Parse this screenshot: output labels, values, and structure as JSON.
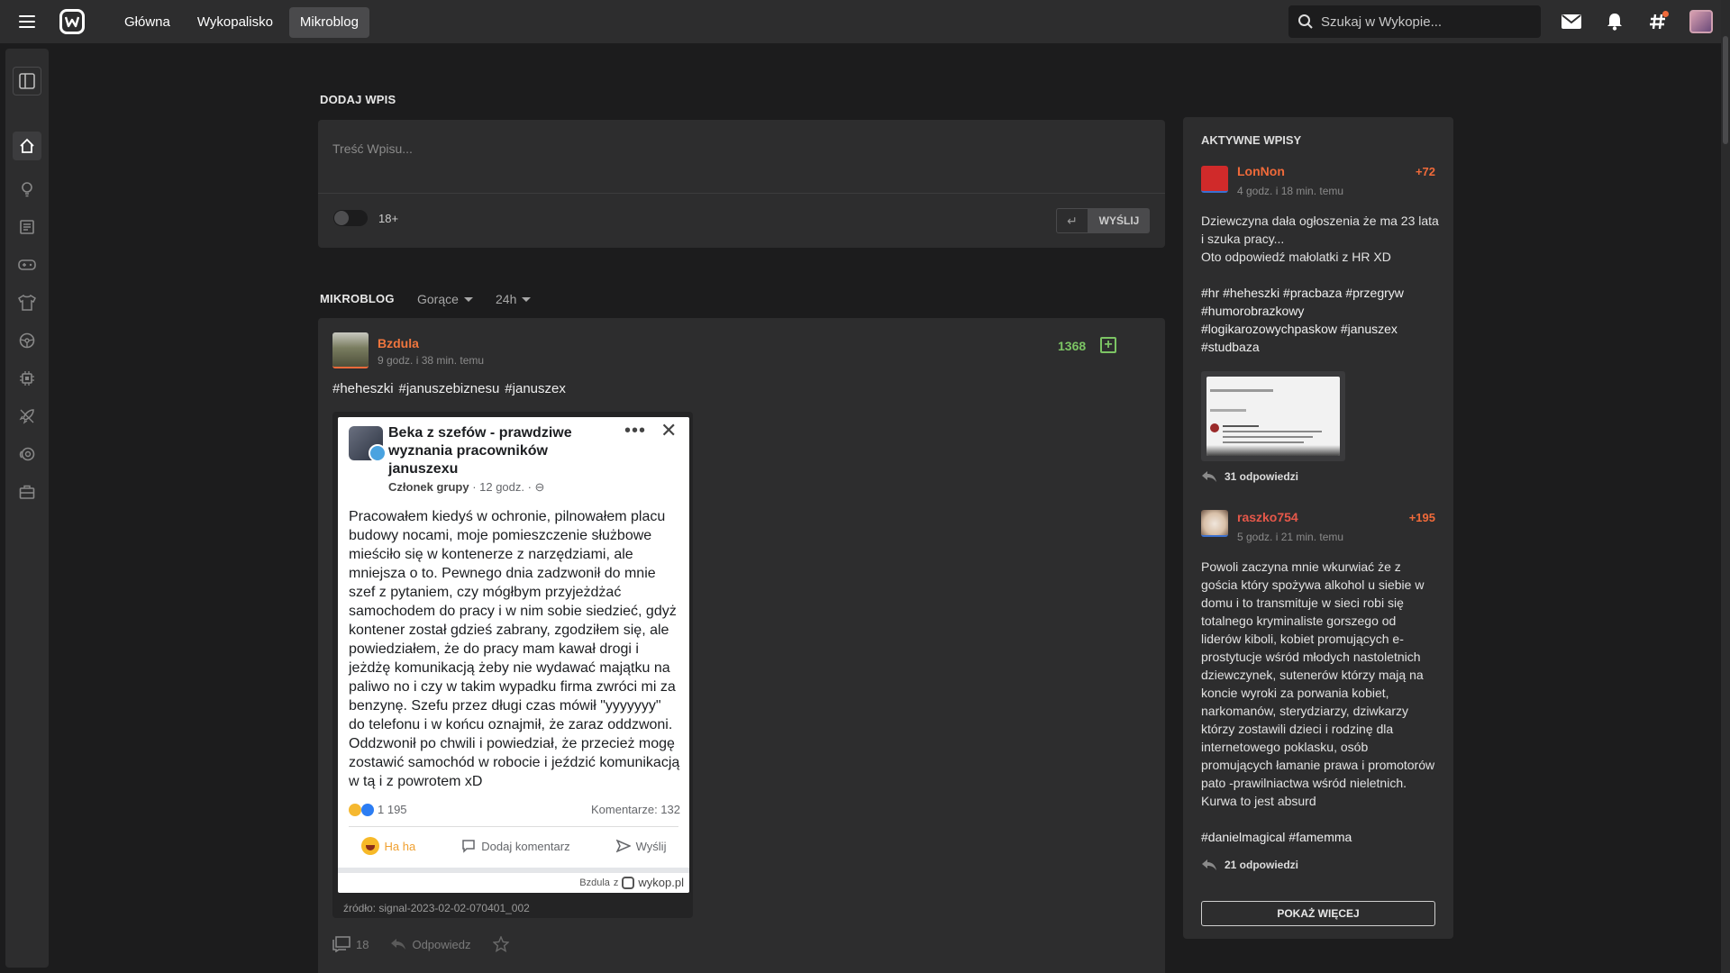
{
  "topbar": {
    "nav": [
      "Główna",
      "Wykopalisko",
      "Mikroblog"
    ],
    "active_nav": "Mikroblog",
    "search_placeholder": "Szukaj w Wykopie..."
  },
  "sidebar": {
    "icons": [
      "panel-toggle-icon",
      "home-icon",
      "lightbulb-icon",
      "news-icon",
      "gamepad-icon",
      "tshirt-icon",
      "steering-wheel-icon",
      "chip-icon",
      "rocket-icon",
      "coin-icon",
      "briefcase-icon"
    ]
  },
  "composer": {
    "section_title": "DODAJ WPIS",
    "placeholder": "Treść Wpisu...",
    "age_label": "18+",
    "send_label": "WYŚLIJ"
  },
  "feed": {
    "section_title": "MIKROBLOG",
    "sort_label": "Gorące",
    "period_label": "24h"
  },
  "post": {
    "author": "Bzdula",
    "time": "9 godz. i 38 min. temu",
    "votes": "1368",
    "tags": [
      "#heheszki",
      "#januszebiznesu",
      "#januszex"
    ],
    "embed": {
      "title": "Beka z szefów - prawdziwe wyznania pracowników januszexu",
      "subtitle_bold": "Członek grupy",
      "subtitle_rest": " · 12 godz. · ⊖",
      "text": "Pracowałem kiedyś w ochronie, pilnowałem placu budowy nocami, moje pomieszczenie służbowe mieściło się w kontenerze z narzędziami, ale mniejsza o to. Pewnego dnia zadzwonił do mnie szef z pytaniem, czy mógłbym przyjeżdżać samochodem do pracy i w nim sobie siedzieć, gdyż kontener został gdzieś zabrany, zgodziłem się, ale powiedziałem, że do pracy mam kawał drogi i jeżdżę komunikacją żeby nie wydawać majątku na paliwo no i czy w takim wypadku firma zwróci mi za benzynę. Szefu przez długi czas mówił \"yyyyyyy\" do telefonu i w końcu oznajmił, że zaraz oddzwoni. Oddzwonił po chwili i powiedział, że przecież mogę zostawić samochód w robocie i jeździć komunikacją w tą i z powrotem xD",
      "reactions": "1 195",
      "comments": "Komentarze: 132",
      "action_haha": "Ha ha",
      "action_comment": "Dodaj komentarz",
      "action_send": "Wyślij",
      "watermark_user": "Bzdula",
      "watermark_z": "z",
      "watermark_site": "wykop.pl",
      "source": "źródło: signal-2023-02-02-070401_002"
    },
    "comment_count": "18",
    "reply_label": "Odpowiedz"
  },
  "active": {
    "title": "AKTYWNE WPISY",
    "entries": [
      {
        "author": "LonNon",
        "author_color": "#f06a3a",
        "time": "4 godz. i 18 min. temu",
        "votes": "+72",
        "body": "Dziewczyna dała ogłoszenia że ma 23 lata i szuka pracy...\nOto odpowiedź małolatki z HR XD",
        "tags": "#hr #heheszki #pracbaza #przegryw #humorobrazkowy #logikarozowychpaskow #januszex #studbaza",
        "replies": "31 odpowiedzi"
      },
      {
        "author": "raszko754",
        "author_color": "#e6584a",
        "time": "5 godz. i 21 min. temu",
        "votes": "+195",
        "body": "Powoli zaczyna mnie wkurwiać że z gościa który spożywa alkohol u siebie w domu i to transmituje w sieci robi się totalnego kryminaliste gorszego od liderów kiboli, kobiet promujących e-prostytucje wśród młodych nastoletnich dziewczynek, sutenerów którzy mają na koncie wyroki za porwania kobiet, narkomanów, sterydziarzy, dziwkarzy którzy zostawili dzieci i rodzinę dla internetowego poklasku, osób promujących łamanie prawa i promotorów pato -prawilniactwa wśród nieletnich. Kurwa to jest absurd",
        "tags": "#danielmagical #famemma",
        "replies": "21 odpowiedzi"
      }
    ],
    "show_more": "POKAŻ WIĘCEJ"
  }
}
